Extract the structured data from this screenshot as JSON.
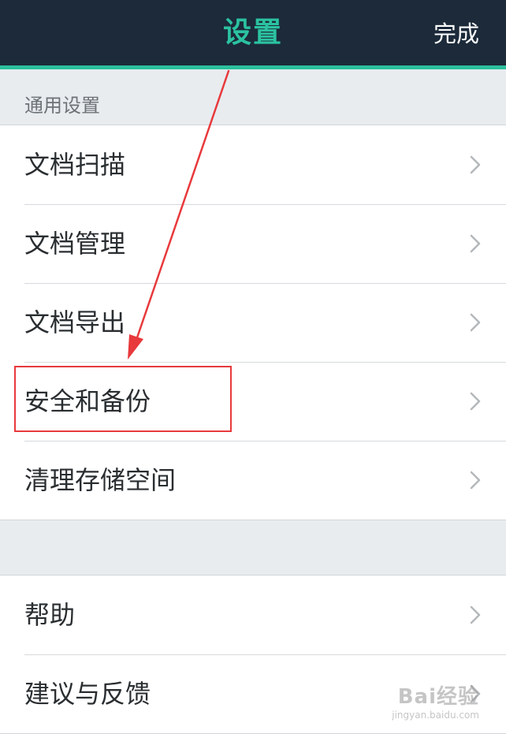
{
  "header": {
    "title": "设置",
    "done_label": "完成"
  },
  "sections": {
    "general_title": "通用设置"
  },
  "general_items": [
    {
      "label": "文档扫描",
      "icon": "chevron-right-icon"
    },
    {
      "label": "文档管理",
      "icon": "chevron-right-icon"
    },
    {
      "label": "文档导出",
      "icon": "chevron-right-icon"
    },
    {
      "label": "安全和备份",
      "icon": "chevron-right-icon"
    },
    {
      "label": "清理存储空间",
      "icon": "chevron-right-icon"
    }
  ],
  "support_items": [
    {
      "label": "帮助",
      "icon": "chevron-right-icon"
    },
    {
      "label": "建议与反馈",
      "icon": "chevron-right-icon"
    }
  ],
  "annotation": {
    "color": "#e8393c",
    "highlighted_item": "安全和备份"
  },
  "watermark": {
    "logo": "Bai经验",
    "url": "jingyan.baidu.com"
  },
  "colors": {
    "nav_background": "#1c2a3a",
    "accent": "#2bc2a0",
    "page_background": "#e8ecef"
  }
}
